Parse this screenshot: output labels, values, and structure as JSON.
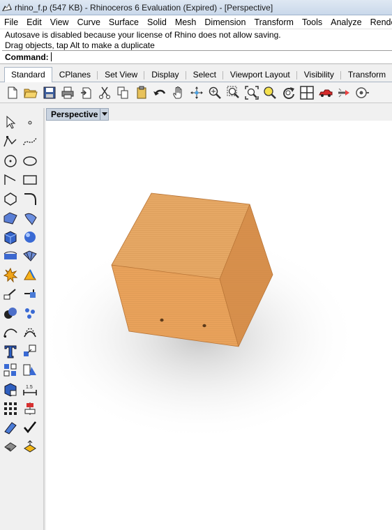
{
  "window": {
    "title": "rhino_f.p (547 KB) - Rhinoceros 6 Evaluation (Expired) - [Perspective]"
  },
  "menu": {
    "items": [
      "File",
      "Edit",
      "View",
      "Curve",
      "Surface",
      "Solid",
      "Mesh",
      "Dimension",
      "Transform",
      "Tools",
      "Analyze",
      "Render"
    ]
  },
  "command_history": {
    "line1": "Autosave is disabled because your license of Rhino does not allow saving.",
    "line2": "Drag objects, tap Alt to make a duplicate"
  },
  "command": {
    "label": "Command:",
    "value": ""
  },
  "tabs": {
    "items": [
      "Standard",
      "CPlanes",
      "Set View",
      "Display",
      "Select",
      "Viewport Layout",
      "Visibility",
      "Transform"
    ],
    "active": "Standard"
  },
  "toolbar": {
    "icons": [
      "new-document-icon",
      "open-folder-icon",
      "save-icon",
      "print-icon",
      "import-icon",
      "cut-icon",
      "copy-icon",
      "paste-icon",
      "undo-icon",
      "pan-hand-icon",
      "rotate-view-icon",
      "zoom-dynamic-icon",
      "zoom-window-icon",
      "zoom-extents-icon",
      "zoom-selected-icon",
      "rotate-icon",
      "four-viewports-icon",
      "car-render-icon",
      "lights-icon",
      "options-icon"
    ]
  },
  "left_toolbar": {
    "icons": [
      "select-arrow-icon",
      "point-icon",
      "polyline-icon",
      "curve-icon",
      "circle-icon",
      "ellipse-icon",
      "arc-icon",
      "rectangle-icon",
      "polygon-icon",
      "fillet-curve-icon",
      "surface-from-points-icon",
      "surface-edit-icon",
      "solid-box-icon",
      "solid-sphere-icon",
      "extrude-icon",
      "mesh-icon",
      "explode-icon",
      "trim-icon",
      "split-icon",
      "join-icon",
      "boolean-union-icon",
      "points-on-icon",
      "curve-edit-icon",
      "control-points-icon",
      "text-icon",
      "scale-icon",
      "group-icon",
      "block-icon",
      "render-solid-icon",
      "dimension-icon",
      "array-icon",
      "align-icon",
      "analyze-icon",
      "check-icon",
      "shade-icon",
      "layer-icon"
    ]
  },
  "viewport": {
    "name": "Perspective",
    "background_color": "#ffffff",
    "object": "wooden-cube"
  },
  "colors": {
    "cube_top": "#e6a865",
    "cube_left": "#e9a25b",
    "cube_right": "#d78f4c",
    "tab_active_bg": "#ffffff",
    "viewport_tab_bg": "#c9d3e0"
  }
}
